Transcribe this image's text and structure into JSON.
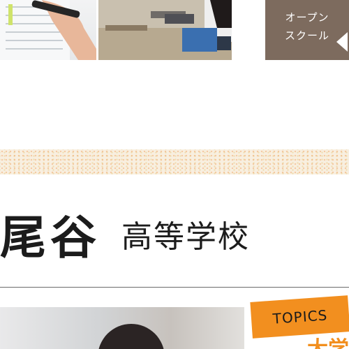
{
  "header": {
    "open_school_line1": "オープン",
    "open_school_line2": "スクール"
  },
  "school": {
    "name_main": "尾谷",
    "name_sub": "高等学校"
  },
  "topics": {
    "badge": "TOPICS",
    "headline": "大学"
  },
  "colors": {
    "open_school_bg": "#7d6b5e",
    "topics_accent": "#f28f1f",
    "text": "#1c1c1c"
  }
}
